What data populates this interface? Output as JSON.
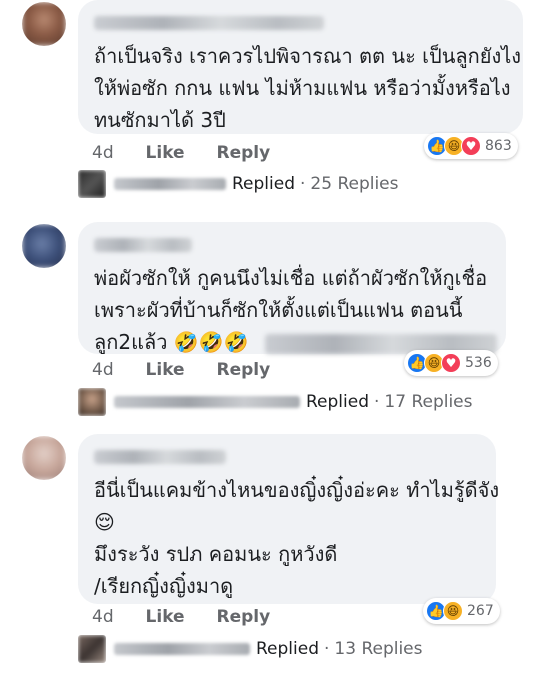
{
  "comments": [
    {
      "lines": [
        "ถ้าเป็นจริง เราควรไปพิจารณา ตต นะ เป็นลูกยังไง",
        "ให้พ่อซัก กกน แฟน ไม่ห้ามแฟน หรือว่ามั้งหรือไง",
        "ทนซักมาได้ 3ปี"
      ],
      "time": "4d",
      "like": "Like",
      "reply": "Reply",
      "reaction_count": "863",
      "reactions": [
        "like",
        "haha",
        "love"
      ],
      "replied_label": "Replied",
      "replies_count": "25 Replies"
    },
    {
      "lines": [
        "พ่อผัวซักให้ กูคนนึงไม่เชื่อ แต่ถ้าผัวซักให้กูเชื่อ",
        "เพราะผัวที่บ้านก็ซักให้ตั้งแต่เป็นแฟน ตอนนี้",
        "ลูก2แล้ว"
      ],
      "emoji_line3": "🤣🤣🤣",
      "time": "4d",
      "like": "Like",
      "reply": "Reply",
      "reaction_count": "536",
      "reactions": [
        "like",
        "haha",
        "love"
      ],
      "replied_label": "Replied",
      "replies_count": "17 Replies"
    },
    {
      "lines": [
        "อีนี่เป็นแคมข้างไหนของญิ๋งญิ๋งอ่ะคะ ทำไมรู้ดีจัง",
        "มึงระวัง รปภ คอมนะ กูหวังดี",
        "/เรียกญิ๋งญิ๋งมาดู"
      ],
      "emoji_line2": "😌",
      "time": "4d",
      "like": "Like",
      "reply": "Reply",
      "reaction_count": "267",
      "reactions": [
        "like",
        "haha"
      ],
      "replied_label": "Replied",
      "replies_count": "13 Replies"
    }
  ],
  "icons": {
    "like": "👍",
    "haha": "😆",
    "love": "♥"
  },
  "colors": {
    "bubble": "#f0f2f5",
    "like": "#1877f2",
    "haha": "#f7b125",
    "love": "#f33e58",
    "meta_text": "#65676b"
  }
}
